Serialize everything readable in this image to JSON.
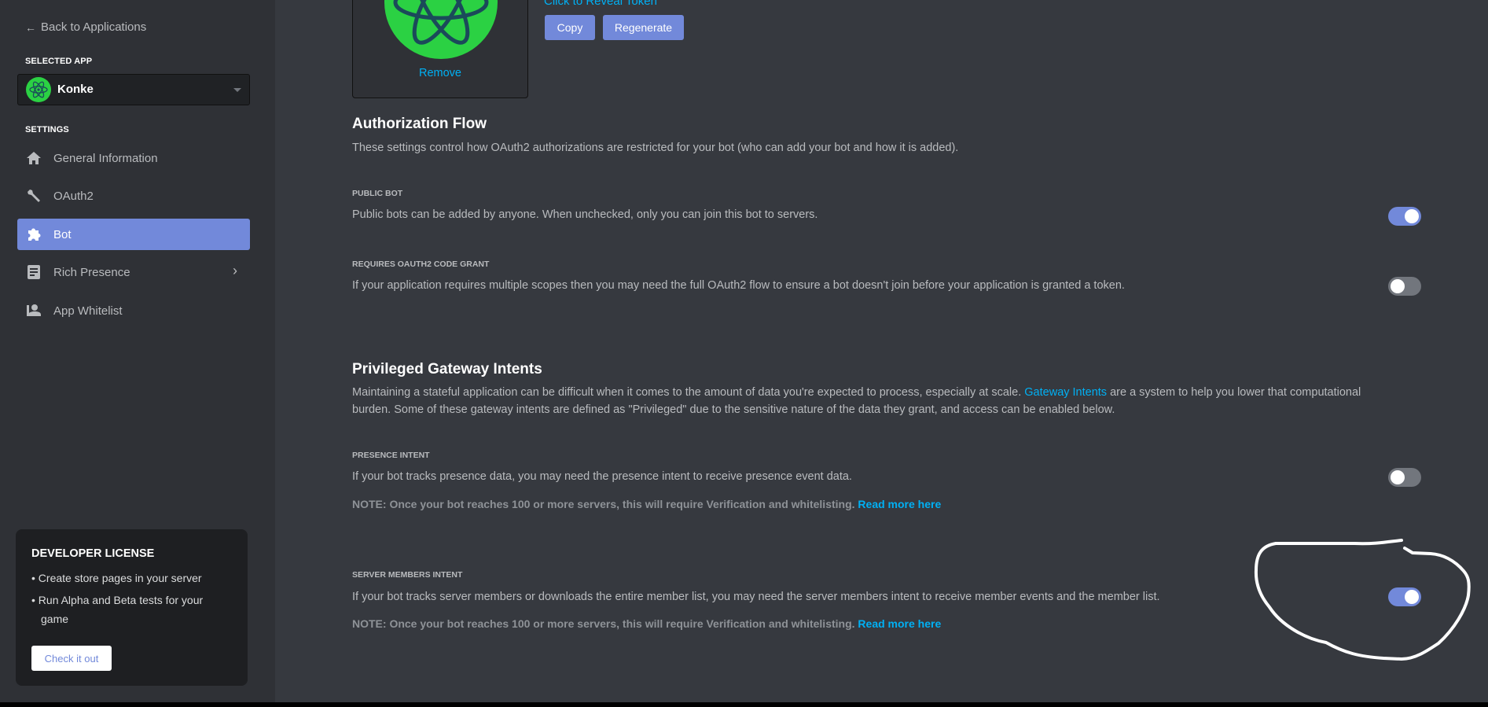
{
  "sidebar": {
    "back_label": "Back to Applications",
    "selected_app_heading": "SELECTED APP",
    "selected_app": "Konke",
    "settings_heading": "SETTINGS",
    "items": [
      {
        "label": "General Information",
        "icon": "home-icon"
      },
      {
        "label": "OAuth2",
        "icon": "wrench-icon"
      },
      {
        "label": "Bot",
        "icon": "puzzle-icon",
        "active": true
      },
      {
        "label": "Rich Presence",
        "icon": "document-icon",
        "has_chevron": true
      },
      {
        "label": "App Whitelist",
        "icon": "person-icon"
      }
    ],
    "license": {
      "title": "DEVELOPER LICENSE",
      "bullets": [
        "Create store pages in your server",
        "Run Alpha and Beta tests for your game"
      ],
      "button": "Check it out"
    }
  },
  "main": {
    "avatar_remove": "Remove",
    "token_link": "Click to Reveal Token",
    "copy_label": "Copy",
    "regenerate_label": "Regenerate",
    "auth": {
      "title": "Authorization Flow",
      "description": "These settings control how OAuth2 authorizations are restricted for your bot (who can add your bot and how it is added).",
      "public_bot": {
        "label": "PUBLIC BOT",
        "text": "Public bots can be added by anyone. When unchecked, only you can join this bot to servers.",
        "enabled": true
      },
      "code_grant": {
        "label": "REQUIRES OAUTH2 CODE GRANT",
        "text": "If your application requires multiple scopes then you may need the full OAuth2 flow to ensure a bot doesn't join before your application is granted a token.",
        "enabled": false
      }
    },
    "intents": {
      "title": "Privileged Gateway Intents",
      "desc_before": "Maintaining a stateful application can be difficult when it comes to the amount of data you're expected to process, especially at scale. ",
      "desc_link": "Gateway Intents",
      "desc_after": " are a system to help you lower that computational",
      "desc_line2": "burden. Some of these gateway intents are defined as \"Privileged\" due to the sensitive nature of the data they grant, and access can be enabled below.",
      "presence": {
        "label": "PRESENCE INTENT",
        "text": "If your bot tracks presence data, you may need the presence intent to receive presence event data.",
        "note": "NOTE: Once your bot reaches 100 or more servers, this will require Verification and whitelisting.",
        "link": "Read more here",
        "enabled": false
      },
      "members": {
        "label": "SERVER MEMBERS INTENT",
        "text": "If your bot tracks server members or downloads the entire member list, you may need the server members intent to receive member events and the member list.",
        "note": "NOTE: Once your bot reaches 100 or more servers, this will require Verification and whitelisting.",
        "link": "Read more here",
        "enabled": true
      }
    }
  },
  "colors": {
    "accent": "#7289da",
    "link": "#00b0f4",
    "avatar_green": "#2bd143",
    "annotation": "#ffffff"
  }
}
